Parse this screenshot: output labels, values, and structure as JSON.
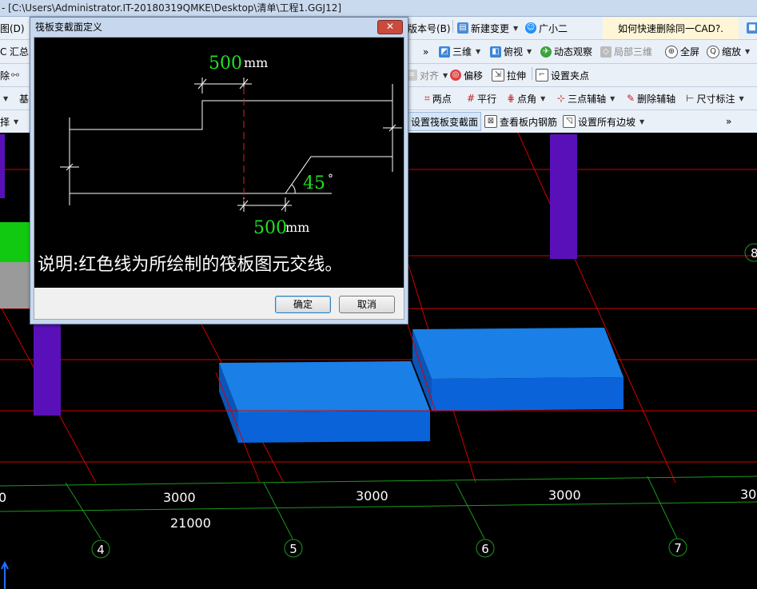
{
  "window": {
    "title": "- [C:\\Users\\Administrator.IT-20180319QMKE\\Desktop\\清单\\工程1.GGJ12]"
  },
  "toolbar1": {
    "menu_partial": "图(D)",
    "version": "版本号(B)",
    "new_change": "新建变更",
    "assistant": "广小二",
    "help_link": "如何快速删除同一CAD?."
  },
  "toolbar2": {
    "left_c": "C",
    "left_summary": "汇总",
    "view3d": "三维",
    "top_view": "俯视",
    "orbit": "动态观察",
    "local3d": "局部三维",
    "fullscreen": "全屏",
    "zoom": "缩放"
  },
  "toolbar3": {
    "left_delete": "除",
    "align": "对齐",
    "offset": "偏移",
    "stretch": "拉伸",
    "grip": "设置夹点"
  },
  "toolbar4": {
    "left_base": "基",
    "two_point": "两点",
    "parallel": "平行",
    "point_angle": "点角",
    "three_point_axis": "三点辅轴",
    "delete_axis": "删除辅轴",
    "dimension": "尺寸标注"
  },
  "toolbar5": {
    "left_select": "择",
    "set_raft_section": "设置筏板变截面",
    "view_rebar": "查看板内钢筋",
    "set_all_edges": "设置所有边坡"
  },
  "viewport": {
    "dims": [
      "0",
      "3000",
      "3000",
      "3000",
      "30"
    ],
    "total": "21000",
    "axes": [
      "4",
      "5",
      "6",
      "7"
    ],
    "axis_right": "8"
  },
  "dialog": {
    "title": "筏板变截面定义",
    "close": "✕",
    "dim_top": "500",
    "dim_top_unit": "mm",
    "dim_bottom": "500",
    "dim_bottom_unit": "mm",
    "angle": "45",
    "angle_unit": "°",
    "note": "说明:红色线为所绘制的筏板图元交线。",
    "ok": "确定",
    "cancel": "取消"
  },
  "colors": {
    "grid_red": "#d40000",
    "grid_green": "#1a9a1a",
    "slab_blue": "#0a63d9",
    "column_purple": "#5a10b8",
    "dim_green": "#22e022"
  }
}
